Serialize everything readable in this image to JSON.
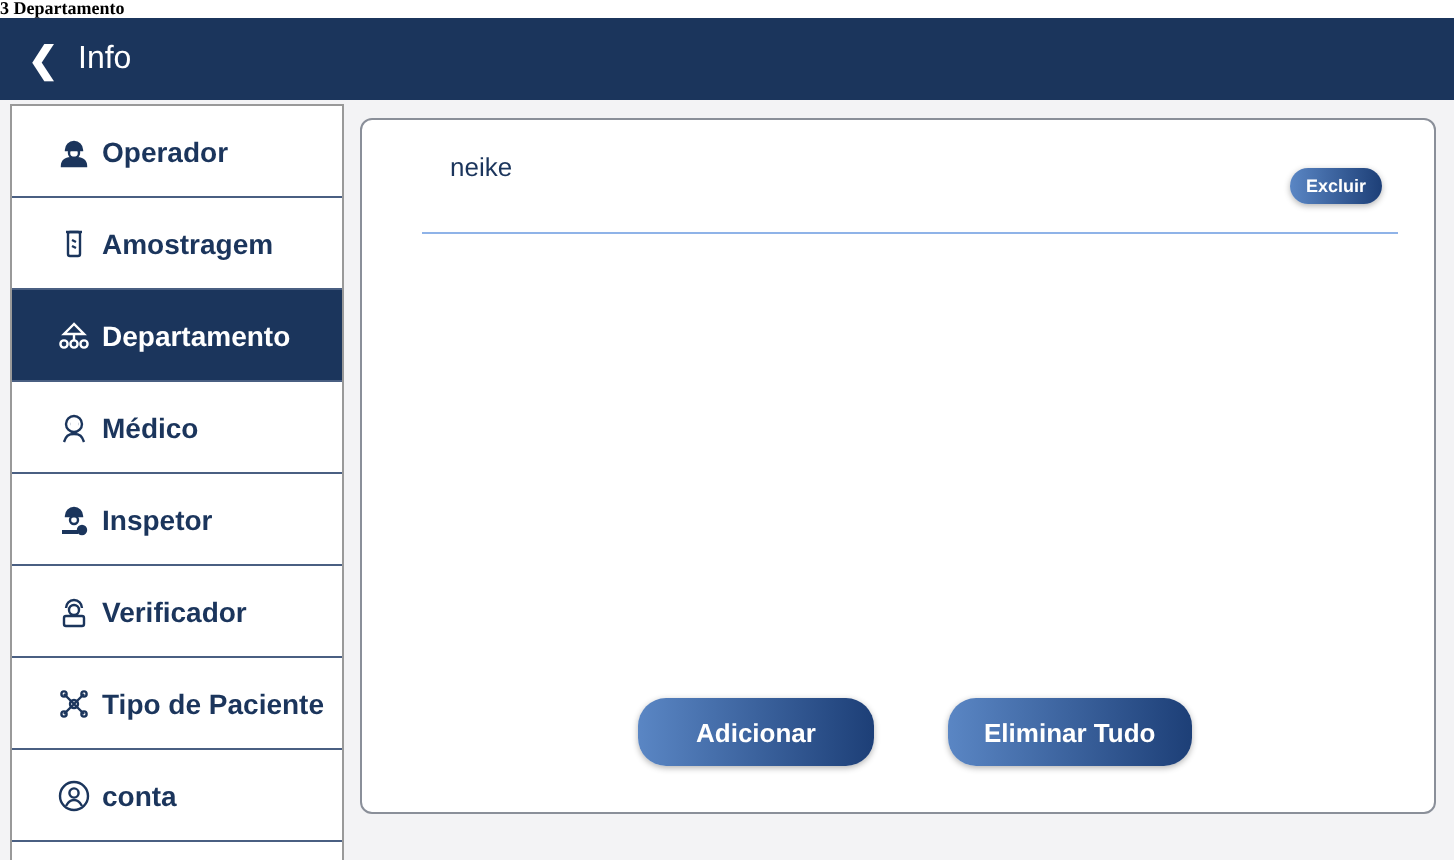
{
  "page_title": "3 Departamento",
  "header": {
    "back_icon": "❮",
    "title": "Info"
  },
  "sidebar": {
    "items": [
      {
        "label": "Operador",
        "selected": false
      },
      {
        "label": "Amostragem",
        "selected": false
      },
      {
        "label": "Departamento",
        "selected": true
      },
      {
        "label": "Médico",
        "selected": false
      },
      {
        "label": "Inspetor",
        "selected": false
      },
      {
        "label": "Verificador",
        "selected": false
      },
      {
        "label": "Tipo de Paciente",
        "selected": false
      },
      {
        "label": "conta",
        "selected": false
      }
    ]
  },
  "list": {
    "rows": [
      {
        "name": "neike",
        "action": "Excluir"
      }
    ]
  },
  "buttons": [
    "Adicionar",
    "Eliminar Tudo"
  ]
}
